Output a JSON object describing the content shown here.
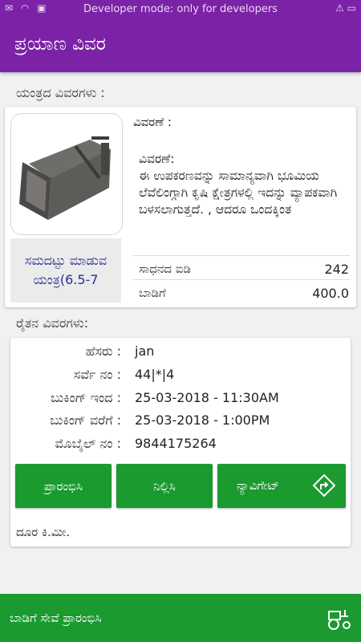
{
  "status_bar": {
    "left_icons": "✉ ◠ ▣",
    "center_text": "Developer mode: only for developers",
    "right_icons": "⚠ ▭"
  },
  "app_bar": {
    "title": "ಪ್ರಯಾಣ ವಿವರ"
  },
  "machine_section": {
    "heading": "ಯಂತ್ರದ ವಿವರಗಳು :",
    "machine_name": "ಸಮದಟ್ಟು ಮಾಡುವ ಯಂತ್ರ(6.5-7",
    "description_label": "ವಿವರಣೆ :",
    "description_text": "ವಿವರಣೆ:\nಈ ಉಪಕರಣವನ್ನು ಸಾಮಾನ್ಯವಾಗಿ ಭೂಮಿಯ ಲೆವೆಲಿಂಗ್ಗಾಗಿ ಕೃಷಿ ಕ್ಷೇತ್ರಗಳಲ್ಲಿ ಇದನ್ನು ವ್ಯಾಪಕವಾಗಿ ಬಳಸಲಾಗುತ್ತದೆ. , ಆದರೂ ಒಂದಕ್ಕಿಂತ",
    "equipment_id_label": "ಸಾಧನದ ಐಡಿ",
    "equipment_id_value": "242",
    "rent_label": "ಬಾಡಿಗೆ",
    "rent_value": "400.0"
  },
  "farmer_section": {
    "heading": "ರೈತನ ವಿವರಗಳು:",
    "rows": [
      {
        "label": "ಹೆಸರು :",
        "value": "jan"
      },
      {
        "label": "ಸರ್ವೆ ನಂ :",
        "value": "44|*|4"
      },
      {
        "label": "ಬುಕಿಂಗ್ ಇಂದ :",
        "value": "25-03-2018 - 11:30AM"
      },
      {
        "label": "ಬುಕಿಂಗ್ ವರೆಗೆ :",
        "value": "25-03-2018 - 1:00PM"
      },
      {
        "label": "ಮೊಬೈಲ್ ನಂ :",
        "value": "9844175264"
      }
    ],
    "buttons": {
      "start": "ಪ್ರಾರಂಭಿಸಿ",
      "stop": "ನಿಲ್ಲಿಸಿ",
      "navigate": "ನ್ಯಾವಿಗೇಟ್"
    },
    "distance_label": "ದೂರ ಕಿ.ಮೀ."
  },
  "bottom_bar": {
    "label": "ಬಾಡಿಗೆ ಸೇವೆ ಪ್ರಾರಂಭಿಸಿ",
    "icon": "tractor-icon"
  },
  "colors": {
    "primary": "#7b22a6",
    "accent_green": "#1a9a2f",
    "link_blue": "#2b2e8f"
  }
}
